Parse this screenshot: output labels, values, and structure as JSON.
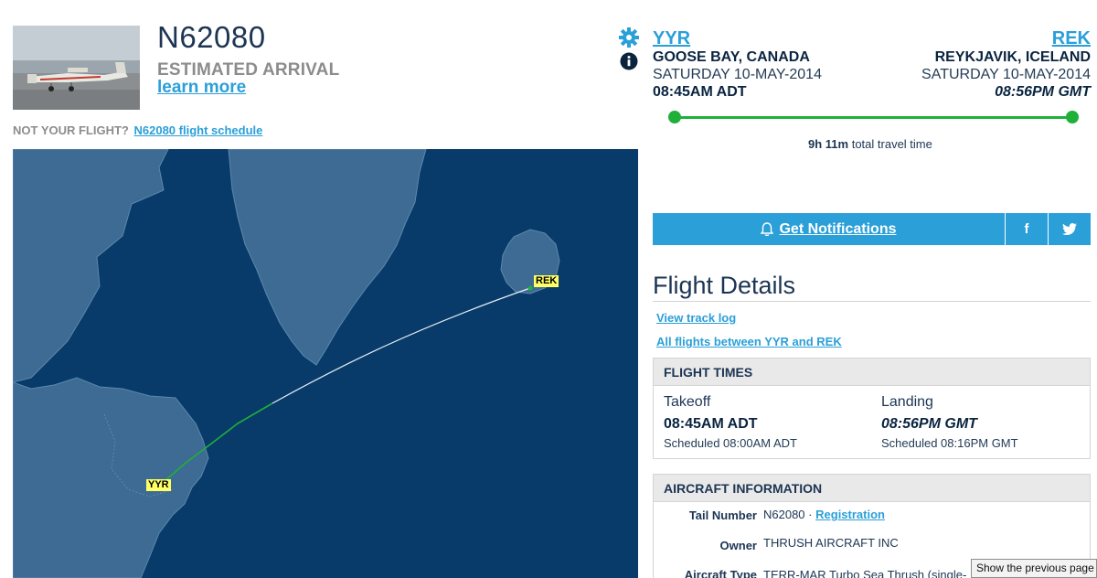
{
  "flight": {
    "ident": "N62080",
    "status": "ESTIMATED ARRIVAL",
    "learn_more": "learn more",
    "not_your_flight": "NOT YOUR FLIGHT?",
    "schedule_link": "N62080 flight schedule"
  },
  "route": {
    "origin": {
      "code": "YYR",
      "city": "GOOSE BAY, CANADA",
      "date": "SATURDAY 10-MAY-2014",
      "time": "08:45AM ADT"
    },
    "destination": {
      "code": "REK",
      "city": "REYKJAVIK, ICELAND",
      "date": "SATURDAY 10-MAY-2014",
      "time": "08:56PM GMT"
    },
    "travel_time": "9h 11m",
    "travel_suffix": "total travel time"
  },
  "map": {
    "origin_label": "YYR",
    "destination_label": "REK"
  },
  "actions": {
    "notifications": "Get Notifications",
    "facebook": "f",
    "twitter_icon": "twitter-icon"
  },
  "details": {
    "title": "Flight Details",
    "view_track_log": "View track log",
    "all_flights": "All flights between YYR and REK",
    "flight_times": {
      "header": "FLIGHT TIMES",
      "takeoff_label": "Takeoff",
      "takeoff_time": "08:45AM ADT",
      "takeoff_scheduled": "Scheduled 08:00AM ADT",
      "landing_label": "Landing",
      "landing_time": "08:56PM GMT",
      "landing_scheduled": "Scheduled 08:16PM GMT"
    },
    "aircraft": {
      "header": "AIRCRAFT INFORMATION",
      "tail_label": "Tail Number",
      "tail_value": "N62080",
      "separator": "·",
      "registration_link": "Registration",
      "owner_label": "Owner",
      "owner_value": "THRUSH AIRCRAFT INC",
      "type_label": "Aircraft Type",
      "type_value": "TERR-MAR Turbo Sea Thrush (single-"
    }
  },
  "tooltip": "Show the previous page",
  "colors": {
    "accent": "#2a9fd8",
    "ocean": "#083b69",
    "land": "#3d6b93",
    "route_green": "#1fb03a",
    "label_yellow": "#ffff66"
  }
}
